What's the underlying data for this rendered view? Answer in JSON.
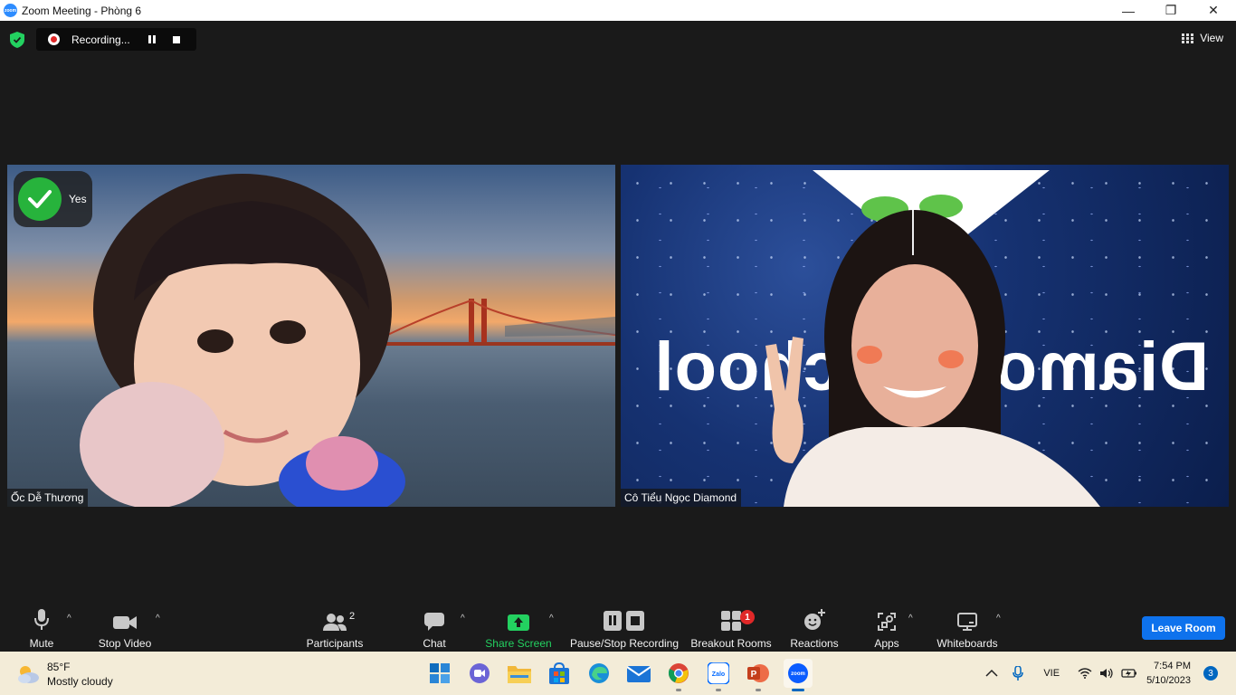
{
  "window": {
    "app_icon_text": "zoom",
    "title": "Zoom Meeting - Phòng 6",
    "minimize": "—",
    "maximize": "❐",
    "close": "✕"
  },
  "topbar": {
    "recording_label": "Recording...",
    "view_label": "View"
  },
  "tiles": [
    {
      "name": "Ốc Dễ Thương",
      "reaction_label": "Yes"
    },
    {
      "name": "Cô Tiểu Ngọc Diamond",
      "background_text": "Diamond School"
    }
  ],
  "toolbar": {
    "mute": "Mute",
    "stop_video": "Stop Video",
    "participants": "Participants",
    "participants_count": "2",
    "chat": "Chat",
    "share_screen": "Share Screen",
    "pause_stop_recording": "Pause/Stop Recording",
    "breakout_rooms": "Breakout Rooms",
    "breakout_badge": "1",
    "reactions": "Reactions",
    "apps": "Apps",
    "whiteboards": "Whiteboards",
    "leave_room": "Leave Room",
    "caret": "^"
  },
  "taskbar": {
    "temperature": "85°F",
    "weather_desc": "Mostly cloudy",
    "apps": [
      "windows-start",
      "teams-meet",
      "file-explorer",
      "microsoft-store",
      "edge",
      "mail",
      "chrome",
      "zalo",
      "powerpoint",
      "zoom"
    ],
    "zalo_text": "Zalo",
    "powerpoint_letter": "P",
    "zoom_text": "zoom",
    "input_language": "VIE",
    "time": "7:54 PM",
    "date": "5/10/2023",
    "notifications": "3"
  },
  "colors": {
    "accent_blue": "#0e72ed",
    "share_green": "#23d160",
    "record_red": "#e02828",
    "reaction_green": "#27b33c"
  }
}
